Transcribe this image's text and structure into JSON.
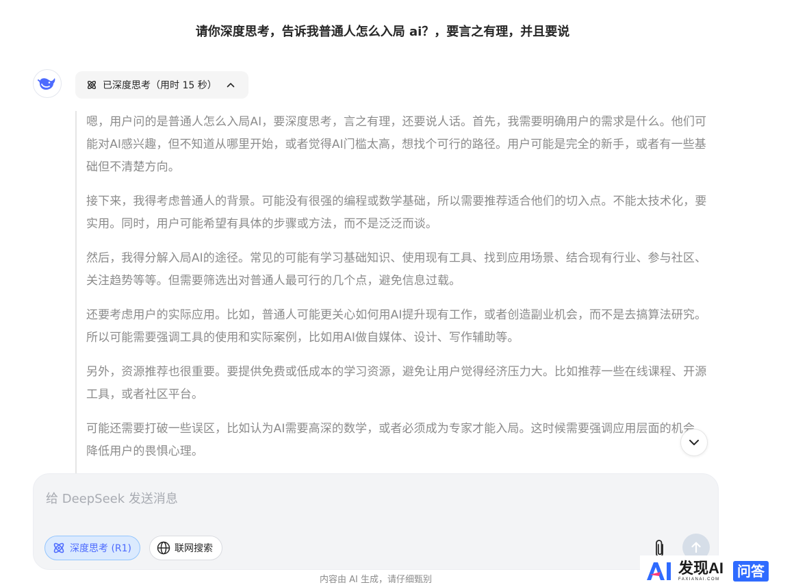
{
  "conversation": {
    "user_question": "请你深度思考，告诉我普通人怎么入局 ai？，要言之有理，并且要说",
    "reasoning_toggle": {
      "label": "已深度思考（用时 15 秒）"
    },
    "reasoning_paragraphs": [
      "嗯，用户问的是普通人怎么入局AI，要深度思考，言之有理，还要说人话。首先，我需要明确用户的需求是什么。他们可能对AI感兴趣，但不知道从哪里开始，或者觉得AI门槛太高，想找个可行的路径。用户可能是完全的新手，或者有一些基础但不清楚方向。",
      "接下来，我得考虑普通人的背景。可能没有很强的编程或数学基础，所以需要推荐适合他们的切入点。不能太技术化，要实用。同时，用户可能希望有具体的步骤或方法，而不是泛泛而谈。",
      "然后，我得分解入局AI的途径。常见的可能有学习基础知识、使用现有工具、找到应用场景、结合现有行业、参与社区、关注趋势等等。但需要筛选出对普通人最可行的几个点，避免信息过载。",
      "还要考虑用户的实际应用。比如，普通人可能更关心如何用AI提升现有工作，或者创造副业机会，而不是去搞算法研究。所以可能需要强调工具的使用和实际案例，比如用AI做自媒体、设计、写作辅助等。",
      "另外，资源推荐也很重要。要提供免费或低成本的学习资源，避免让用户觉得经济压力大。比如推荐一些在线课程、开源工具，或者社区平台。",
      "可能还需要打破一些误区，比如认为AI需要高深的数学，或者必须成为专家才能入局。这时候需要强调应用层面的机会，降低用户的畏惧心理。"
    ]
  },
  "composer": {
    "placeholder": "给 DeepSeek 发送消息",
    "deep_think_label": "深度思考 (R1)",
    "web_search_label": "联网搜索"
  },
  "footer": {
    "disclaimer": "内容由 AI 生成，请仔细甄别"
  },
  "watermark": {
    "brand": "发现AI",
    "domain": "FAXIANAI.COM",
    "tag": "问答"
  },
  "icons": {
    "avatar": "deepseek-whale-icon",
    "think": "atom-icon",
    "chevron": "chevron-up-icon",
    "scroll": "chevron-down-icon",
    "search": "globe-icon",
    "attach": "paperclip-icon",
    "send": "arrow-up-icon"
  },
  "colors": {
    "accent": "#4d6bfe",
    "reasoning_text": "#8b8b8b",
    "composer_bg": "#f3f4f6",
    "watermark_tag": "#2f6bff"
  }
}
